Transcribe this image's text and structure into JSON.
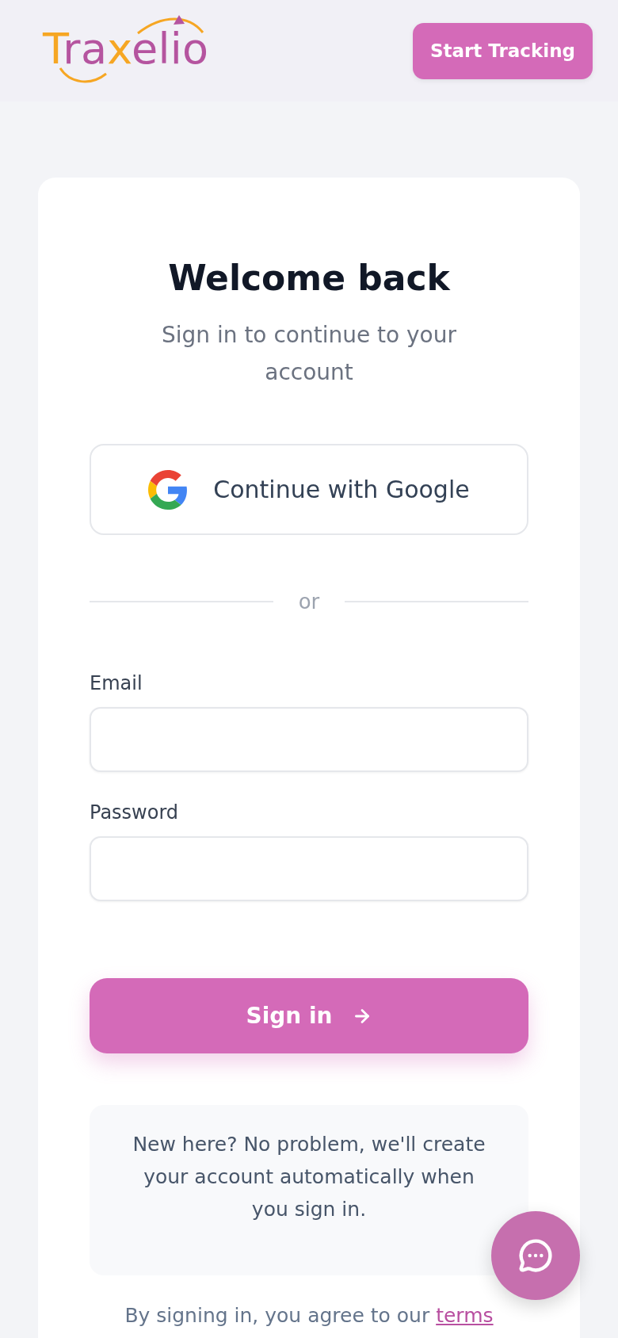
{
  "header": {
    "logo": "Traxelio",
    "cta_button": "Start Tracking"
  },
  "card": {
    "title": "Welcome back",
    "subtitle": "Sign in to continue to your account",
    "google_button": "Continue with Google",
    "divider": "or",
    "fields": [
      {
        "label": "Email"
      },
      {
        "label": "Password"
      }
    ],
    "submit_button": "Sign in",
    "notice": "New here? No problem, we'll create your account automatically when you sign in.",
    "terms": {
      "text": "By signing in, you agree to our",
      "link": "terms"
    }
  }
}
